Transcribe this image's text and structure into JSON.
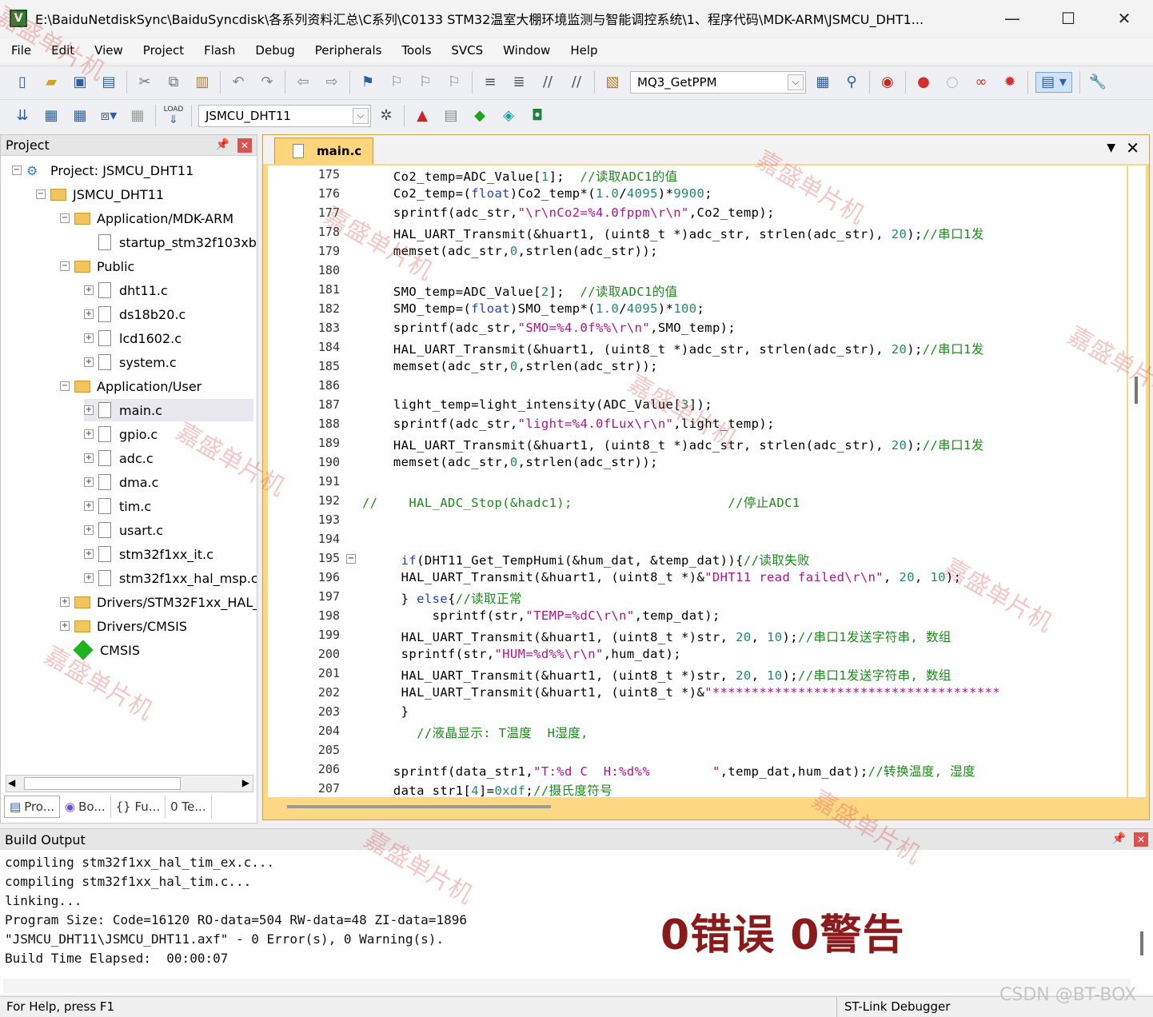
{
  "window": {
    "title": "E:\\BaiduNetdiskSync\\BaiduSyncdisk\\各系列资料汇总\\C系列\\C0133 STM32温室大棚环境监测与智能调控系统\\1、程序代码\\MDK-ARM\\JSMCU_DHT1...",
    "minimize": "—",
    "maximize": "☐",
    "close": "✕"
  },
  "menu": [
    "File",
    "Edit",
    "View",
    "Project",
    "Flash",
    "Debug",
    "Peripherals",
    "Tools",
    "SVCS",
    "Window",
    "Help"
  ],
  "toolbar": {
    "find_combo": "MQ3_GetPPM",
    "target_combo": "JSMCU_DHT11",
    "load_label": "LOAD"
  },
  "project_panel": {
    "title": "Project",
    "tree": [
      {
        "label": "Project: JSMCU_DHT11",
        "type": "project",
        "level": 0,
        "exp": "−"
      },
      {
        "label": "JSMCU_DHT11",
        "type": "target",
        "level": 1,
        "exp": "−"
      },
      {
        "label": "Application/MDK-ARM",
        "type": "folder",
        "level": 2,
        "exp": "−"
      },
      {
        "label": "startup_stm32f103xb",
        "type": "file",
        "level": 3,
        "exp": ""
      },
      {
        "label": "Public",
        "type": "folder",
        "level": 2,
        "exp": "−"
      },
      {
        "label": "dht11.c",
        "type": "file",
        "level": 3,
        "exp": "+"
      },
      {
        "label": "ds18b20.c",
        "type": "file",
        "level": 3,
        "exp": "+"
      },
      {
        "label": "lcd1602.c",
        "type": "file",
        "level": 3,
        "exp": "+"
      },
      {
        "label": "system.c",
        "type": "file",
        "level": 3,
        "exp": "+"
      },
      {
        "label": "Application/User",
        "type": "folder",
        "level": 2,
        "exp": "−"
      },
      {
        "label": "main.c",
        "type": "file",
        "level": 3,
        "exp": "+"
      },
      {
        "label": "gpio.c",
        "type": "file",
        "level": 3,
        "exp": "+"
      },
      {
        "label": "adc.c",
        "type": "file",
        "level": 3,
        "exp": "+"
      },
      {
        "label": "dma.c",
        "type": "file",
        "level": 3,
        "exp": "+"
      },
      {
        "label": "tim.c",
        "type": "file",
        "level": 3,
        "exp": "+"
      },
      {
        "label": "usart.c",
        "type": "file",
        "level": 3,
        "exp": "+"
      },
      {
        "label": "stm32f1xx_it.c",
        "type": "file",
        "level": 3,
        "exp": "+"
      },
      {
        "label": "stm32f1xx_hal_msp.c",
        "type": "file",
        "level": 3,
        "exp": "+"
      },
      {
        "label": "Drivers/STM32F1xx_HAL_Driver",
        "type": "folder",
        "level": 2,
        "exp": "+"
      },
      {
        "label": "Drivers/CMSIS",
        "type": "folder",
        "level": 2,
        "exp": "+"
      },
      {
        "label": "CMSIS",
        "type": "cmsis",
        "level": 2,
        "exp": ""
      }
    ],
    "tabs": [
      "Pro...",
      "Bo...",
      "{} Fu...",
      "0 Te..."
    ]
  },
  "editor": {
    "tab": "main.c",
    "lines": [
      {
        "n": "175",
        "html": "    Co2_temp=ADC_Value[<span class=\"nm\">1</span>];  <span class=\"cm\">//读取ADC1的值</span>"
      },
      {
        "n": "176",
        "html": "    Co2_temp=(<span class=\"kw\">float</span>)Co2_temp*(<span class=\"nm\">1.0</span>/<span class=\"nm\">4095</span>)*<span class=\"nm\">9900</span>;"
      },
      {
        "n": "177",
        "html": "    sprintf(adc_str,<span class=\"st\">\"\\r\\nCo2=%4.0fppm\\r\\n\"</span>,Co2_temp);"
      },
      {
        "n": "178",
        "html": "    HAL_UART_Transmit(&amp;huart1, (uint8_t *)adc_str, strlen(adc_str), <span class=\"nm\">20</span>);<span class=\"cm\">//串口1发</span>"
      },
      {
        "n": "179",
        "html": "    memset(adc_str,<span class=\"nm\">0</span>,strlen(adc_str));"
      },
      {
        "n": "180",
        "html": ""
      },
      {
        "n": "181",
        "html": "    SMO_temp=ADC_Value[<span class=\"nm\">2</span>];  <span class=\"cm\">//读取ADC1的值</span>"
      },
      {
        "n": "182",
        "html": "    SMO_temp=(<span class=\"kw\">float</span>)SMO_temp*(<span class=\"nm\">1.0</span>/<span class=\"nm\">4095</span>)*<span class=\"nm\">100</span>;"
      },
      {
        "n": "183",
        "html": "    sprintf(adc_str,<span class=\"st\">\"SMO=%4.0f%%\\r\\n\"</span>,SMO_temp);"
      },
      {
        "n": "184",
        "html": "    HAL_UART_Transmit(&amp;huart1, (uint8_t *)adc_str, strlen(adc_str), <span class=\"nm\">20</span>);<span class=\"cm\">//串口1发</span>"
      },
      {
        "n": "185",
        "html": "    memset(adc_str,<span class=\"nm\">0</span>,strlen(adc_str));"
      },
      {
        "n": "186",
        "html": ""
      },
      {
        "n": "187",
        "html": "    light_temp=light_intensity(ADC_Value[<span class=\"nm\">3</span>]);"
      },
      {
        "n": "188",
        "html": "    sprintf(adc_str,<span class=\"st\">\"light=%4.0fLux\\r\\n\"</span>,light_temp);"
      },
      {
        "n": "189",
        "html": "    HAL_UART_Transmit(&amp;huart1, (uint8_t *)adc_str, strlen(adc_str), <span class=\"nm\">20</span>);<span class=\"cm\">//串口1发</span>"
      },
      {
        "n": "190",
        "html": "    memset(adc_str,<span class=\"nm\">0</span>,strlen(adc_str));"
      },
      {
        "n": "191",
        "html": ""
      },
      {
        "n": "192",
        "html": "<span class=\"cm\">//    HAL_ADC_Stop(&amp;hadc1);                    //停止ADC1</span>"
      },
      {
        "n": "193",
        "html": ""
      },
      {
        "n": "194",
        "html": ""
      },
      {
        "n": "195",
        "html": "     <span class=\"kw\">if</span>(DHT11_Get_TempHumi(&amp;hum_dat, &amp;temp_dat)){<span class=\"cm\">//读取失败</span>"
      },
      {
        "n": "196",
        "html": "     HAL_UART_Transmit(&amp;huart1, (uint8_t *)&amp;<span class=\"st\">\"DHT11 read failed\\r\\n\"</span>, <span class=\"nm\">20</span>, <span class=\"nm\">10</span>);"
      },
      {
        "n": "197",
        "html": "     } <span class=\"kw\">else</span>{<span class=\"cm\">//读取正常</span>"
      },
      {
        "n": "198",
        "html": "         sprintf(str,<span class=\"st\">\"TEMP=%dC\\r\\n\"</span>,temp_dat);"
      },
      {
        "n": "199",
        "html": "     HAL_UART_Transmit(&amp;huart1, (uint8_t *)str, <span class=\"nm\">20</span>, <span class=\"nm\">10</span>);<span class=\"cm\">//串口1发送字符串, 数组</span>"
      },
      {
        "n": "200",
        "html": "     sprintf(str,<span class=\"st\">\"HUM=%d%%\\r\\n\"</span>,hum_dat);"
      },
      {
        "n": "201",
        "html": "     HAL_UART_Transmit(&amp;huart1, (uint8_t *)str, <span class=\"nm\">20</span>, <span class=\"nm\">10</span>);<span class=\"cm\">//串口1发送字符串, 数组</span>"
      },
      {
        "n": "202",
        "html": "     HAL_UART_Transmit(&amp;huart1, (uint8_t *)&amp;<span class=\"st\">\"*************************************</span>"
      },
      {
        "n": "203",
        "html": "     }"
      },
      {
        "n": "204",
        "html": "       <span class=\"cm\">//液晶显示: T温度  H湿度,</span>"
      },
      {
        "n": "205",
        "html": ""
      },
      {
        "n": "206",
        "html": "    sprintf(data_str1,<span class=\"st\">\"T:%d C  H:%d%%        \"</span>,temp_dat,hum_dat);<span class=\"cm\">//转换温度, 湿度</span>"
      },
      {
        "n": "207",
        "html": "    data_str1[<span class=\"nm\">4</span>]=<span class=\"nm\">0xdf</span>;<span class=\"cm\">//摄氏度符号</span>"
      }
    ]
  },
  "build_output": {
    "title": "Build Output",
    "lines": [
      "compiling stm32f1xx_hal_tim_ex.c...",
      "compiling stm32f1xx_hal_tim.c...",
      "linking...",
      "Program Size: Code=16120 RO-data=504 RW-data=48 ZI-data=1896",
      "\"JSMCU_DHT11\\JSMCU_DHT11.axf\" - 0 Error(s), 0 Warning(s).",
      "Build Time Elapsed:  00:00:07"
    ],
    "note": "0错误 0警告"
  },
  "status": {
    "left": "For Help, press F1",
    "right": "ST-Link Debugger"
  },
  "watermark_text": "嘉盛单片机",
  "csdn_mark": "CSDN @BT-BOX"
}
